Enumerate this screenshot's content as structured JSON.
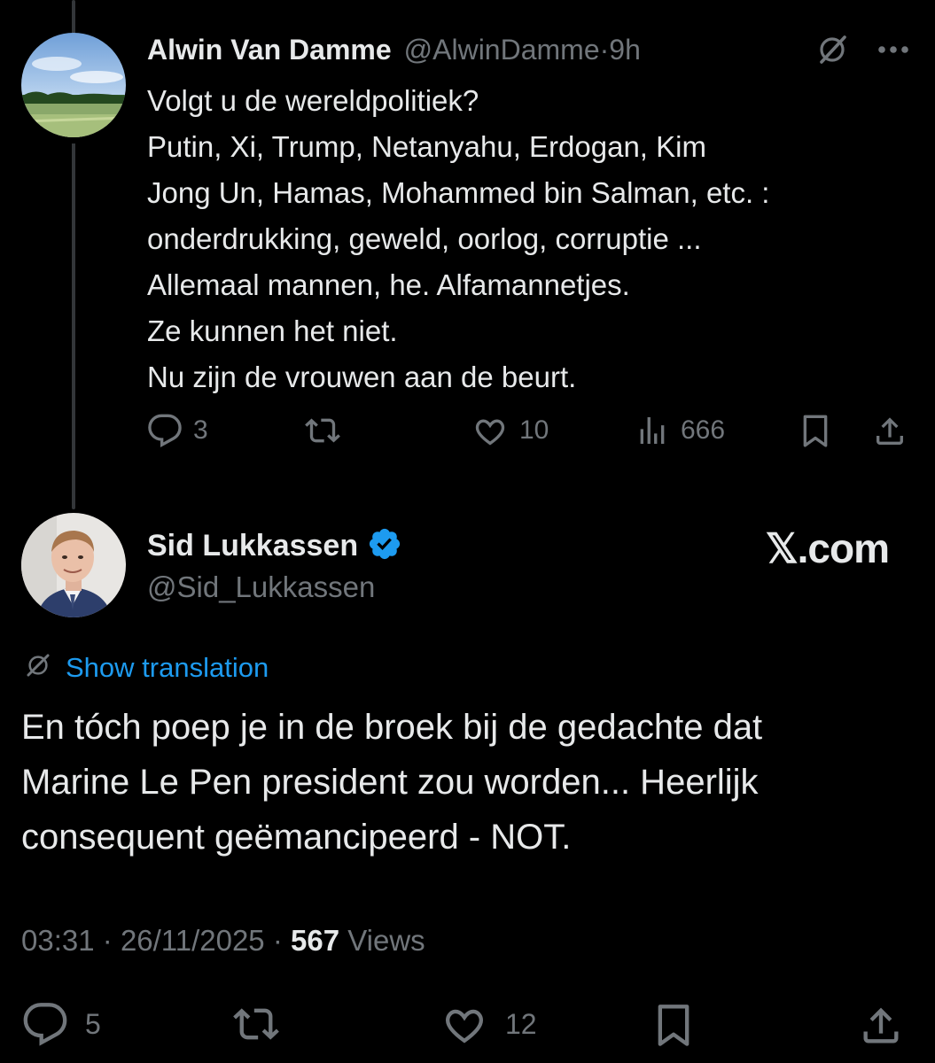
{
  "parent_tweet": {
    "author_name": "Alwin Van Damme",
    "handle": "@AlwinDamme",
    "separator": "·",
    "time": "9h",
    "body_lines": [
      "Volgt u de wereldpolitiek?",
      "Putin, Xi, Trump, Netanyahu, Erdogan, Kim",
      "Jong Un, Hamas, Mohammed bin Salman, etc. :",
      "onderdrukking, geweld, oorlog, corruptie ...",
      "Allemaal mannen, he. Alfamannetjes.",
      "Ze kunnen het niet.",
      "Nu zijn de vrouwen aan de beurt."
    ],
    "replies": "3",
    "likes": "10",
    "views": "666"
  },
  "main_tweet": {
    "author_name": "Sid Lukkassen",
    "handle": "@Sid_Lukkassen",
    "verified": true,
    "watermark": "𝕏.com",
    "translate_label": "Show translation",
    "body_lines": [
      "En tóch poep je in de broek bij de gedachte dat",
      "Marine Le Pen president zou worden... Heerlijk",
      "consequent geëmancipeerd - NOT."
    ],
    "time": "03:31",
    "date": "26/11/2025",
    "views_count": "567",
    "views_label": "Views",
    "replies": "5",
    "likes": "12"
  },
  "icons": {
    "reply": "reply-icon",
    "retweet": "retweet-icon",
    "like": "like-icon",
    "views": "views-icon",
    "bookmark": "bookmark-icon",
    "share": "share-icon",
    "grok": "grok-icon",
    "more": "more-icon",
    "verified": "verified-badge-icon",
    "translate": "translate-icon"
  },
  "colors": {
    "background": "#000000",
    "text": "#e7e9ea",
    "secondary": "#71767b",
    "accent": "#1d9bf0"
  }
}
